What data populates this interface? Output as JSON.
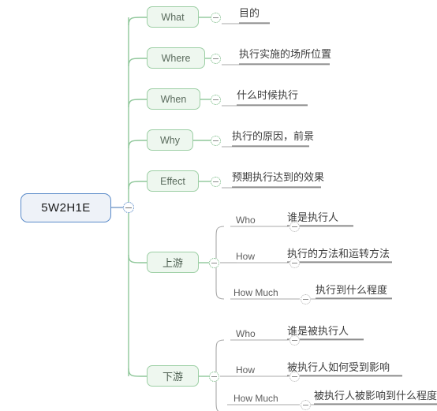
{
  "diagram": {
    "type": "mind-map",
    "title": "5W2H1E",
    "colors": {
      "root_fill": "#eef2f8",
      "root_border": "#5b8bc9",
      "branch_fill": "#eef7ef",
      "branch_border": "#9dcfa5",
      "trunk_line": "#8fc79a",
      "sub_line": "#a8a8a8",
      "leaf_underline": "#808080",
      "text_dark": "#3c3c3c",
      "text_gray": "#5d5d5d"
    },
    "root": {
      "label": "5W2H1E",
      "toggle_icon": "minus-circle-icon"
    },
    "branches": [
      {
        "id": "what",
        "label": "What",
        "leaf": "目的",
        "toggle_icon": "minus-circle-icon"
      },
      {
        "id": "where",
        "label": "Where",
        "leaf": "执行实施的场所位置",
        "toggle_icon": "minus-circle-icon"
      },
      {
        "id": "when",
        "label": "When",
        "leaf": "什么时候执行",
        "toggle_icon": "minus-circle-icon"
      },
      {
        "id": "why",
        "label": "Why",
        "leaf": "执行的原因，前景",
        "toggle_icon": "minus-circle-icon"
      },
      {
        "id": "effect",
        "label": "Effect",
        "leaf": "预期执行达到的效果",
        "toggle_icon": "minus-circle-icon"
      },
      {
        "id": "upstream",
        "label": "上游",
        "toggle_icon": "minus-circle-icon",
        "children": [
          {
            "id": "upstream-who",
            "label": "Who",
            "leaf": "谁是执行人",
            "toggle_icon": "minus-circle-icon"
          },
          {
            "id": "upstream-how",
            "label": "How",
            "leaf": "执行的方法和运转方法",
            "toggle_icon": "minus-circle-icon"
          },
          {
            "id": "upstream-how-much",
            "label": "How Much",
            "leaf": "执行到什么程度",
            "toggle_icon": "minus-circle-icon"
          }
        ]
      },
      {
        "id": "downstream",
        "label": "下游",
        "toggle_icon": "minus-circle-icon",
        "children": [
          {
            "id": "downstream-who",
            "label": "Who",
            "leaf": "谁是被执行人",
            "toggle_icon": "minus-circle-icon"
          },
          {
            "id": "downstream-how",
            "label": "How",
            "leaf": "被执行人如何受到影响",
            "toggle_icon": "minus-circle-icon"
          },
          {
            "id": "downstream-how-much",
            "label": "How Much",
            "leaf": "被执行人被影响到什么程度",
            "toggle_icon": "minus-circle-icon"
          }
        ]
      }
    ]
  }
}
